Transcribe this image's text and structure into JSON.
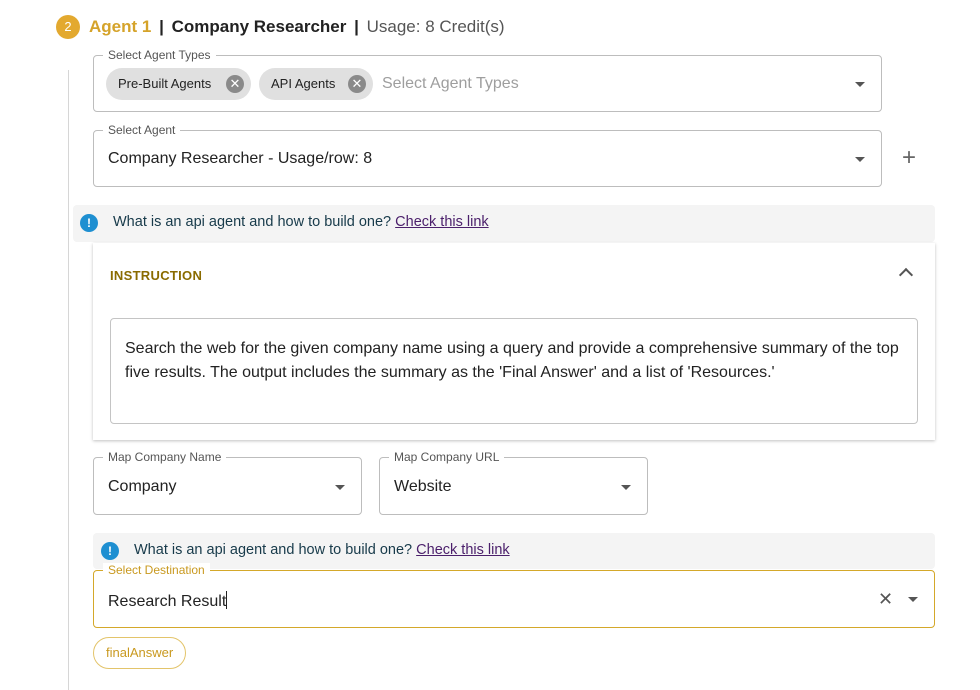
{
  "step": {
    "number": "2",
    "agent_label": "Agent 1",
    "separator": "|",
    "agent_name": "Company Researcher",
    "separator2": "|",
    "usage": "Usage: 8 Credit(s)"
  },
  "agent_types": {
    "label": "Select Agent Types",
    "chips": [
      "Pre-Built Agents",
      "API Agents"
    ],
    "placeholder": "Select Agent Types"
  },
  "select_agent": {
    "label": "Select Agent",
    "value": "Company Researcher - Usage/row: 8",
    "add_icon": "plus-icon"
  },
  "info_alert_1": {
    "text": "What is an api agent and how to build one?",
    "link": "Check this link",
    "icon": "info-icon"
  },
  "instruction": {
    "title": "INSTRUCTION",
    "text": "Search the web for the given company name using a query and provide a comprehensive summary of the top five results. The output includes the summary as the 'Final Answer' and a list of 'Resources.'"
  },
  "map_company_name": {
    "label": "Map Company Name",
    "value": "Company"
  },
  "map_company_url": {
    "label": "Map Company URL",
    "value": "Website"
  },
  "info_alert_2": {
    "text": "What is an api agent and how to build one?",
    "link": "Check this link",
    "icon": "info-icon"
  },
  "destination": {
    "label": "Select Destination",
    "value": "Research Result"
  },
  "output_chip": "finalAnswer",
  "colors": {
    "accent": "#d5a32a",
    "info": "#1e8fd1",
    "link": "#4b1f6b"
  }
}
